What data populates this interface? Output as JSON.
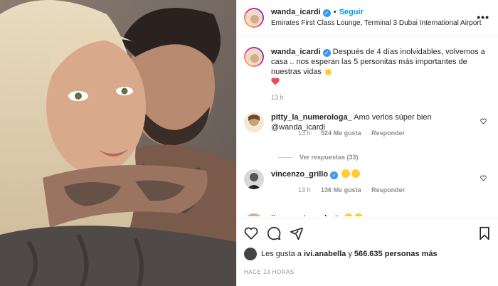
{
  "header": {
    "username": "wanda_icardi",
    "follow_label": "Seguir",
    "separator": "•",
    "location": "Emirates First Class Lounge, Terminal 3 Dubai International Airport",
    "more_label": "•••"
  },
  "caption": {
    "username": "wanda_icardi",
    "text": "Después de 4 días inolvidables, volvemos a casa .. nos esperan las 5 personitas más importantes de nuestras vidas",
    "time": "13 h"
  },
  "comments": [
    {
      "username": "pitty_la_numerologa_",
      "text": "Amo verlos súper bien @wanda_icardi",
      "time": "13 h",
      "likes": "524 Me gusta",
      "reply_label": "Responder"
    },
    {
      "username": "vincenzo_grillo",
      "text": "",
      "time": "13 h",
      "likes": "136 Me gusta",
      "reply_label": "Responder"
    },
    {
      "username": "jimemonteverde",
      "text": ""
    }
  ],
  "view_replies": "Ver respuestas (33)",
  "likes": {
    "prefix": "Les gusta a",
    "user": "ivi.anabella",
    "connector": "y",
    "count": "566.635 personas más"
  },
  "timestamp": "HACE 13 HORAS",
  "colors": {
    "accent": "#0095f6",
    "verified": "#3897f0",
    "heart": "#ed4956"
  }
}
